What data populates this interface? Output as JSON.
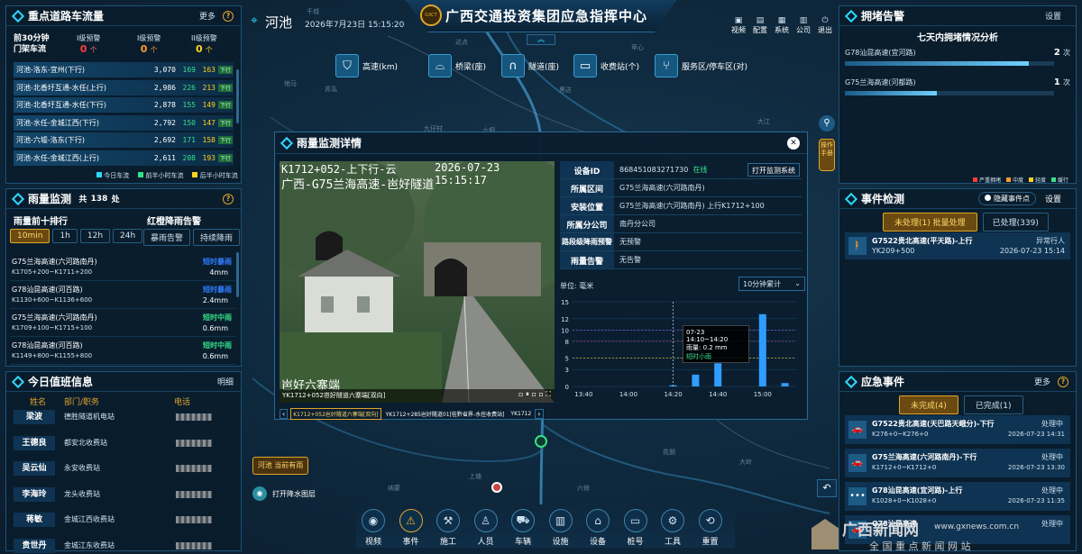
{
  "header": {
    "location": "河池",
    "datetime": "2026年7月23日 15:15:20",
    "title": "广西交通投资集团应急指挥中心",
    "logo_text": "GXCT",
    "right_icons": [
      {
        "label": "视频",
        "icon": "video-icon"
      },
      {
        "label": "配置",
        "icon": "config-icon"
      },
      {
        "label": "系统",
        "icon": "system-icon"
      },
      {
        "label": "公司",
        "icon": "company-icon"
      },
      {
        "label": "退出",
        "icon": "power-icon"
      }
    ]
  },
  "stats": [
    {
      "label": "高速(km)",
      "icon": "road-icon"
    },
    {
      "label": "桥梁(座)",
      "icon": "bridge-icon"
    },
    {
      "label": "隧道(座)",
      "icon": "tunnel-icon"
    },
    {
      "label": "收费站(个)",
      "icon": "tollstation-icon"
    },
    {
      "label": "服务区/停车区(对)",
      "icon": "service-area-icon"
    }
  ],
  "traffic": {
    "title": "重点道路车流量",
    "more": "更多",
    "top_label": "前30分钟 门架车流",
    "levels": [
      {
        "name": "I级预警",
        "count": "0",
        "unit": "个"
      },
      {
        "name": "I级预警",
        "count": "0",
        "unit": "个"
      },
      {
        "name": "II级预警",
        "count": "0",
        "unit": "个"
      }
    ],
    "rows": [
      {
        "name": "河池-洛东-宜州(下行)",
        "v1": "3,070",
        "v2": "169",
        "v3": "163",
        "badge": "下行"
      },
      {
        "name": "河池-北香圩互通-水任(上行)",
        "v1": "2,986",
        "v2": "226",
        "v3": "213",
        "badge": "下行"
      },
      {
        "name": "河池-北香圩互通-水任(下行)",
        "v1": "2,878",
        "v2": "155",
        "v3": "149",
        "badge": "下行"
      },
      {
        "name": "河池-水任-金城江西(下行)",
        "v1": "2,792",
        "v2": "150",
        "v3": "147",
        "badge": "下行"
      },
      {
        "name": "河池-六墟-洛东(下行)",
        "v1": "2,692",
        "v2": "171",
        "v3": "158",
        "badge": "下行"
      },
      {
        "name": "河池-水任-金城江西(上行)",
        "v1": "2,611",
        "v2": "208",
        "v3": "193",
        "badge": "下行"
      }
    ],
    "legend": [
      "今日车流",
      "前半小时车流",
      "后半小时车流"
    ]
  },
  "rain": {
    "title": "雨量监测",
    "total_label": "共",
    "total": "138",
    "total_unit": "处",
    "rank_title": "雨量前十排行",
    "warn_title": "红橙降雨告警",
    "tabs": [
      "10min",
      "1h",
      "12h",
      "24h"
    ],
    "warn_tabs": [
      "暴雨告警",
      "持续降雨"
    ],
    "rows": [
      {
        "name": "G75兰海高速(六河路南丹)",
        "range": "K1705+200~K1711+200",
        "level": "短时暴雨",
        "level_color": "#2f7dff",
        "value": "4mm"
      },
      {
        "name": "G78汕昆高速(河百路)",
        "range": "K1130+600~K1136+600",
        "level": "短时暴雨",
        "level_color": "#2f7dff",
        "value": "2.4mm"
      },
      {
        "name": "G75兰海高速(六河路南丹)",
        "range": "K1709+100~K1715+100",
        "level": "短时中雨",
        "level_color": "#35e08a",
        "value": "0.6mm"
      },
      {
        "name": "G78汕昆高速(河百路)",
        "range": "K1149+800~K1155+800",
        "level": "短时中雨",
        "level_color": "#35e08a",
        "value": "0.6mm"
      }
    ]
  },
  "duty": {
    "title": "今日值班信息",
    "detail": "明细",
    "cols": [
      "姓名",
      "部门/职务",
      "电话"
    ],
    "rows": [
      {
        "name": "梁波",
        "dept": "德胜隧道机电站"
      },
      {
        "name": "王德良",
        "dept": "都安北收费站"
      },
      {
        "name": "吴云仙",
        "dept": "永安收费站"
      },
      {
        "name": "李海玲",
        "dept": "龙头收费站"
      },
      {
        "name": "蒋敏",
        "dept": "金城江西收费站"
      },
      {
        "name": "贵世丹",
        "dept": "金城江东收费站"
      }
    ]
  },
  "congestion": {
    "title": "拥堵告警",
    "setting": "设置",
    "subtitle": "七天内拥堵情况分析",
    "rows": [
      {
        "name": "G78汕昆高速(宜河路)",
        "count": "2",
        "unit": "次",
        "fill": 0.88
      },
      {
        "name": "G75兰海高速(河都路)",
        "count": "1",
        "unit": "次",
        "fill": 0.44
      }
    ],
    "legend": [
      "严重拥堵",
      "中度",
      "轻度",
      "缓行"
    ]
  },
  "events": {
    "title": "事件检测",
    "hide_label": "隐藏事件点",
    "setting": "设置",
    "tabs": [
      "未处理(1) 批量处理",
      "已处理(339)"
    ],
    "items": [
      {
        "title": "G7522贵北高速(平天路)-上行",
        "sub": "YK209+500",
        "status": "异常行人",
        "time": "2026-07-23 15:14"
      }
    ]
  },
  "emergency": {
    "title": "应急事件",
    "more": "更多",
    "tabs": [
      "未完成(4)",
      "已完成(1)"
    ],
    "items": [
      {
        "title": "G7522贵北高速(天巴路天峨分)-下行",
        "sub": "K276+0~K276+0",
        "status": "处理中",
        "time": "2026-07-23 14:31"
      },
      {
        "title": "G75兰海高速(六河路南丹)-下行",
        "sub": "K1712+0~K1712+0",
        "status": "处理中",
        "time": "2026-07-23 13:30"
      },
      {
        "title": "G78汕昆高速(宜河路)-上行",
        "sub": "K1028+0~K1028+0",
        "status": "处理中",
        "time": "2026-07-23 11:35"
      },
      {
        "title": "G78汕昆高速",
        "sub": "",
        "status": "处理中",
        "time": ""
      }
    ]
  },
  "dialog": {
    "title": "雨量监测详情",
    "video_overlay_line1": "K1712+052-上下行-云",
    "video_overlay_time": "2026-07-23 15:15:17",
    "video_overlay_line2": "广西-G75兰海高速-岜好隧道",
    "video_overlay_bottom": "岜好六寨端",
    "video_caption": "YK1712+052岜好隧道六寨端[双向]",
    "camera_tabs": [
      "K1712+052岜好隧道六寨端[双向]",
      "YK1712+285岜好隧道01[桂黔省界-水任收费站]",
      "YK1712"
    ],
    "fields": [
      {
        "label": "设备ID",
        "value": "868451083271730",
        "extra": "在线",
        "button": "打开监测系统"
      },
      {
        "label": "所属区间",
        "value": "G75兰海高速(六河路南丹)"
      },
      {
        "label": "安装位置",
        "value": "G75兰海高速(六河路南丹) 上行K1712+100"
      },
      {
        "label": "所属分公司",
        "value": "南丹分公司"
      },
      {
        "label": "路段级降雨预警",
        "value": "无预警"
      },
      {
        "label": "雨量告警",
        "value": "无告警"
      }
    ],
    "unit_label": "单位: 毫米",
    "select": "10分钟累计",
    "tooltip": {
      "time": "07-23 14:10~14:20",
      "value": "雨量: 0.2 mm",
      "level": "短时小雨"
    }
  },
  "chart_data": {
    "type": "bar",
    "categories": [
      "13:40",
      "13:50",
      "14:00",
      "14:10",
      "14:20",
      "14:30",
      "14:40",
      "14:50",
      "15:00",
      "15:10"
    ],
    "values": [
      0,
      0,
      0,
      0,
      0.2,
      2.1,
      4.1,
      0,
      12.8,
      0.6
    ],
    "xticks": [
      "13:40",
      "14:00",
      "14:20",
      "14:40",
      "15:00"
    ],
    "yticks": [
      0,
      3,
      5,
      8,
      10,
      12,
      15
    ],
    "ylim": [
      0,
      15
    ]
  },
  "map_labels": [
    "千城",
    "达点",
    "苹心",
    "黑达",
    "地马",
    "苏泓",
    "九仔村",
    "六垌",
    "大江",
    "花朋",
    "纳蒙",
    "上塘",
    "六修",
    "大岭"
  ],
  "rain_tag": "河池 当前有雨",
  "toggle_label": "打开降水图层",
  "side_tool": "操作手册",
  "bottom_nav": [
    {
      "label": "视频",
      "icon": "video-icon"
    },
    {
      "label": "事件",
      "icon": "warning-icon"
    },
    {
      "label": "施工",
      "icon": "construction-icon"
    },
    {
      "label": "人员",
      "icon": "person-icon"
    },
    {
      "label": "车辆",
      "icon": "vehicle-icon"
    },
    {
      "label": "设施",
      "icon": "facility-icon"
    },
    {
      "label": "设备",
      "icon": "device-icon"
    },
    {
      "label": "桩号",
      "icon": "stake-icon"
    },
    {
      "label": "工具",
      "icon": "tool-icon"
    },
    {
      "label": "重置",
      "icon": "reset-icon"
    }
  ],
  "watermark": {
    "title": "广西新闻网",
    "url": "www.gxnews.com.cn",
    "sub": "全 国 重 点 新 闻 网 站"
  },
  "colors": {
    "accent": "#2fd7ff",
    "gold": "#e0a52a",
    "panel": "#09202f"
  }
}
